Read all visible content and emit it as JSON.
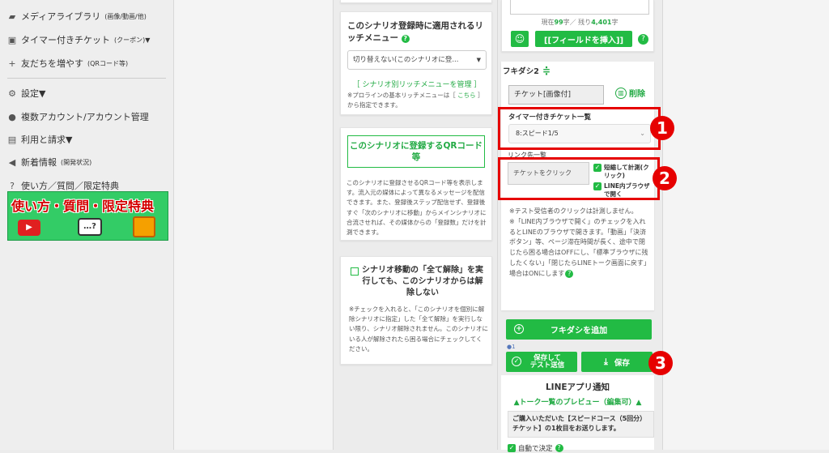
{
  "sidebar": {
    "items": [
      {
        "label": "メディアライブラリ",
        "suffix": "(画像/動画/他)"
      },
      {
        "label": "タイマー付きチケット",
        "suffix": "(クーポン)▼"
      },
      {
        "label": "友だちを増やす",
        "suffix": "(QRコード等)"
      },
      {
        "label": "設定▼",
        "suffix": ""
      },
      {
        "label": "複数アカウント/アカウント管理",
        "suffix": ""
      },
      {
        "label": "利用と請求▼",
        "suffix": ""
      },
      {
        "label": "新着情報",
        "suffix": "(開発状況)"
      },
      {
        "label": "使い方／質問／限定特典",
        "suffix": ""
      }
    ],
    "banner_title": "使い方・質問・限定特典"
  },
  "middle": {
    "rich_menu": {
      "title": "このシナリオ登録時に適用されるリッチメニュー",
      "select_value": "切り替えない(このシナリオに登...",
      "link": "［ シナリオ別リッチメニューを管理 ］",
      "note_pre": "※プロラインの基本リッチメニューは［ ",
      "note_link": "こちら",
      "note_post": " ］から指定できます。"
    },
    "qr": {
      "button": "このシナリオに登録するQRコード等",
      "desc": "このシナリオに登録させるQRコード等を表示します。流入元の媒体によって異なるメッセージを配信できます。また、登録後ステップ配信せず、登録後すぐ「次のシナリオに移動」からメインシナリオに合流させれば、その媒体からの「登録数」だけを計測できます。"
    },
    "release": {
      "title": "シナリオ移動の「全て解除」を実行しても、このシナリオからは解除しない",
      "desc": "※チェックを入れると、「このシナリオを個別に解除シナリオに指定」した「全て解除」を実行しない限り、シナリオ解除されません。このシナリオにいる人が解除されたら困る場合にチェックしてください。"
    }
  },
  "right": {
    "char_count": {
      "prefix": "現在",
      "current": "99",
      "mid": "字／ 残り",
      "remain": "4,401",
      "suffix": "字"
    },
    "insert_field": "[[フィールドを挿入]]",
    "fukidashi_label": "フキダシ2",
    "type_value": "チケット[画像付]",
    "delete_label": "削除",
    "ticket_list_label": "タイマー付きチケット一覧",
    "ticket_select": "8:スピード1/5",
    "link_label": "リンク先一覧",
    "link_value": "チケットをクリック",
    "check1": "短縮して計測(クリック)",
    "check2": "LINE内ブラウザで開く",
    "notes": "※テスト受信者のクリックは計測しません。\n※「LINE内ブラウザで開く」のチェックを入れるとLINEのブラウザで開きます。「動画」「決済ボタン」等、ページ滞在時間が長く、途中で閉じたら困る場合はOFFにし、「標準ブラウザに残したくない」「閉じたらLINEトーク画面に戻す」場合はONにします",
    "add_fukidashi": "フキダシを追加",
    "user_count": "1",
    "save_test": "保存して\nテスト送信",
    "save": "保存",
    "line_notice_title": "LINEアプリ通知",
    "preview_link": "▲トーク一覧のプレビュー（編集可）▲",
    "preview_text": "ご購入いただいた【スピードコース（5回分）チケット】の1枚目をお送りします。",
    "auto_decide": "自動で決定"
  },
  "annotations": [
    "1",
    "2",
    "3"
  ],
  "colors": {
    "accent": "#22bb44",
    "annotation": "#e60000"
  }
}
